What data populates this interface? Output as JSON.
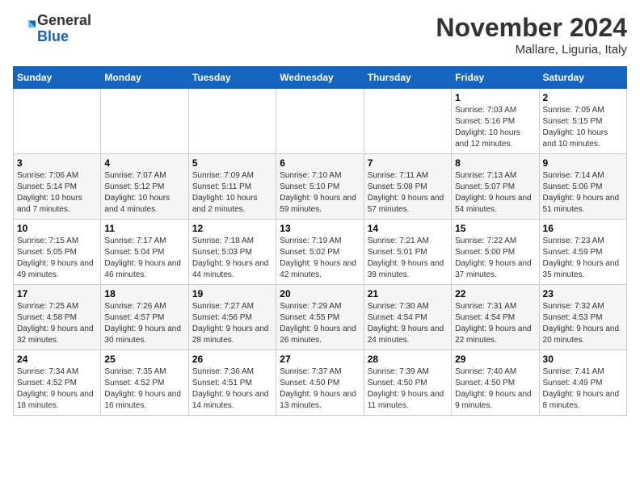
{
  "header": {
    "logo_line1": "General",
    "logo_line2": "Blue",
    "month_title": "November 2024",
    "location": "Mallare, Liguria, Italy"
  },
  "weekdays": [
    "Sunday",
    "Monday",
    "Tuesday",
    "Wednesday",
    "Thursday",
    "Friday",
    "Saturday"
  ],
  "weeks": [
    [
      {
        "day": "",
        "info": ""
      },
      {
        "day": "",
        "info": ""
      },
      {
        "day": "",
        "info": ""
      },
      {
        "day": "",
        "info": ""
      },
      {
        "day": "",
        "info": ""
      },
      {
        "day": "1",
        "info": "Sunrise: 7:03 AM\nSunset: 5:16 PM\nDaylight: 10 hours and 12 minutes."
      },
      {
        "day": "2",
        "info": "Sunrise: 7:05 AM\nSunset: 5:15 PM\nDaylight: 10 hours and 10 minutes."
      }
    ],
    [
      {
        "day": "3",
        "info": "Sunrise: 7:06 AM\nSunset: 5:14 PM\nDaylight: 10 hours and 7 minutes."
      },
      {
        "day": "4",
        "info": "Sunrise: 7:07 AM\nSunset: 5:12 PM\nDaylight: 10 hours and 4 minutes."
      },
      {
        "day": "5",
        "info": "Sunrise: 7:09 AM\nSunset: 5:11 PM\nDaylight: 10 hours and 2 minutes."
      },
      {
        "day": "6",
        "info": "Sunrise: 7:10 AM\nSunset: 5:10 PM\nDaylight: 9 hours and 59 minutes."
      },
      {
        "day": "7",
        "info": "Sunrise: 7:11 AM\nSunset: 5:08 PM\nDaylight: 9 hours and 57 minutes."
      },
      {
        "day": "8",
        "info": "Sunrise: 7:13 AM\nSunset: 5:07 PM\nDaylight: 9 hours and 54 minutes."
      },
      {
        "day": "9",
        "info": "Sunrise: 7:14 AM\nSunset: 5:06 PM\nDaylight: 9 hours and 51 minutes."
      }
    ],
    [
      {
        "day": "10",
        "info": "Sunrise: 7:15 AM\nSunset: 5:05 PM\nDaylight: 9 hours and 49 minutes."
      },
      {
        "day": "11",
        "info": "Sunrise: 7:17 AM\nSunset: 5:04 PM\nDaylight: 9 hours and 46 minutes."
      },
      {
        "day": "12",
        "info": "Sunrise: 7:18 AM\nSunset: 5:03 PM\nDaylight: 9 hours and 44 minutes."
      },
      {
        "day": "13",
        "info": "Sunrise: 7:19 AM\nSunset: 5:02 PM\nDaylight: 9 hours and 42 minutes."
      },
      {
        "day": "14",
        "info": "Sunrise: 7:21 AM\nSunset: 5:01 PM\nDaylight: 9 hours and 39 minutes."
      },
      {
        "day": "15",
        "info": "Sunrise: 7:22 AM\nSunset: 5:00 PM\nDaylight: 9 hours and 37 minutes."
      },
      {
        "day": "16",
        "info": "Sunrise: 7:23 AM\nSunset: 4:59 PM\nDaylight: 9 hours and 35 minutes."
      }
    ],
    [
      {
        "day": "17",
        "info": "Sunrise: 7:25 AM\nSunset: 4:58 PM\nDaylight: 9 hours and 32 minutes."
      },
      {
        "day": "18",
        "info": "Sunrise: 7:26 AM\nSunset: 4:57 PM\nDaylight: 9 hours and 30 minutes."
      },
      {
        "day": "19",
        "info": "Sunrise: 7:27 AM\nSunset: 4:56 PM\nDaylight: 9 hours and 28 minutes."
      },
      {
        "day": "20",
        "info": "Sunrise: 7:29 AM\nSunset: 4:55 PM\nDaylight: 9 hours and 26 minutes."
      },
      {
        "day": "21",
        "info": "Sunrise: 7:30 AM\nSunset: 4:54 PM\nDaylight: 9 hours and 24 minutes."
      },
      {
        "day": "22",
        "info": "Sunrise: 7:31 AM\nSunset: 4:54 PM\nDaylight: 9 hours and 22 minutes."
      },
      {
        "day": "23",
        "info": "Sunrise: 7:32 AM\nSunset: 4:53 PM\nDaylight: 9 hours and 20 minutes."
      }
    ],
    [
      {
        "day": "24",
        "info": "Sunrise: 7:34 AM\nSunset: 4:52 PM\nDaylight: 9 hours and 18 minutes."
      },
      {
        "day": "25",
        "info": "Sunrise: 7:35 AM\nSunset: 4:52 PM\nDaylight: 9 hours and 16 minutes."
      },
      {
        "day": "26",
        "info": "Sunrise: 7:36 AM\nSunset: 4:51 PM\nDaylight: 9 hours and 14 minutes."
      },
      {
        "day": "27",
        "info": "Sunrise: 7:37 AM\nSunset: 4:50 PM\nDaylight: 9 hours and 13 minutes."
      },
      {
        "day": "28",
        "info": "Sunrise: 7:39 AM\nSunset: 4:50 PM\nDaylight: 9 hours and 11 minutes."
      },
      {
        "day": "29",
        "info": "Sunrise: 7:40 AM\nSunset: 4:50 PM\nDaylight: 9 hours and 9 minutes."
      },
      {
        "day": "30",
        "info": "Sunrise: 7:41 AM\nSunset: 4:49 PM\nDaylight: 9 hours and 8 minutes."
      }
    ]
  ]
}
